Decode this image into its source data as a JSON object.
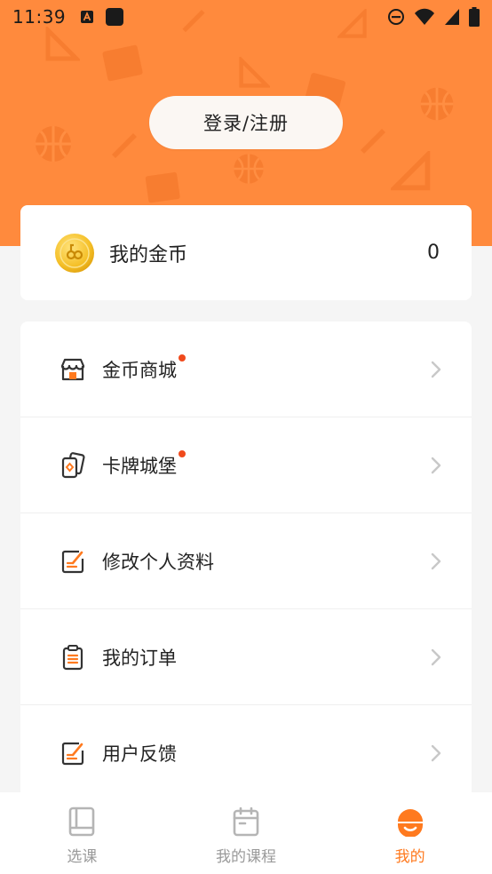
{
  "status_bar": {
    "time": "11:39",
    "left_icons": [
      "a-box-icon",
      "square-app-icon"
    ],
    "right_icons": [
      "do-not-disturb-icon",
      "wifi-icon",
      "signal-icon",
      "battery-icon"
    ]
  },
  "header": {
    "login_label": "登录/注册",
    "background_color": "#ff8a3d"
  },
  "coins": {
    "label": "我的金币",
    "value": "0",
    "icon": "gold-coin-icon"
  },
  "menu": {
    "items": [
      {
        "label": "金币商城",
        "icon": "shop-icon",
        "has_dot": true
      },
      {
        "label": "卡牌城堡",
        "icon": "cards-icon",
        "has_dot": true
      },
      {
        "label": "修改个人资料",
        "icon": "edit-profile-icon",
        "has_dot": false
      },
      {
        "label": "我的订单",
        "icon": "clipboard-icon",
        "has_dot": false
      },
      {
        "label": "用户反馈",
        "icon": "feedback-icon",
        "has_dot": false
      }
    ]
  },
  "tabbar": {
    "tabs": [
      {
        "label": "选课",
        "icon": "book-icon",
        "active": false
      },
      {
        "label": "我的课程",
        "icon": "calendar-icon",
        "active": false
      },
      {
        "label": "我的",
        "icon": "profile-face-icon",
        "active": true
      }
    ],
    "active_color": "#ff7a1f",
    "inactive_color": "#9a9a9a"
  }
}
